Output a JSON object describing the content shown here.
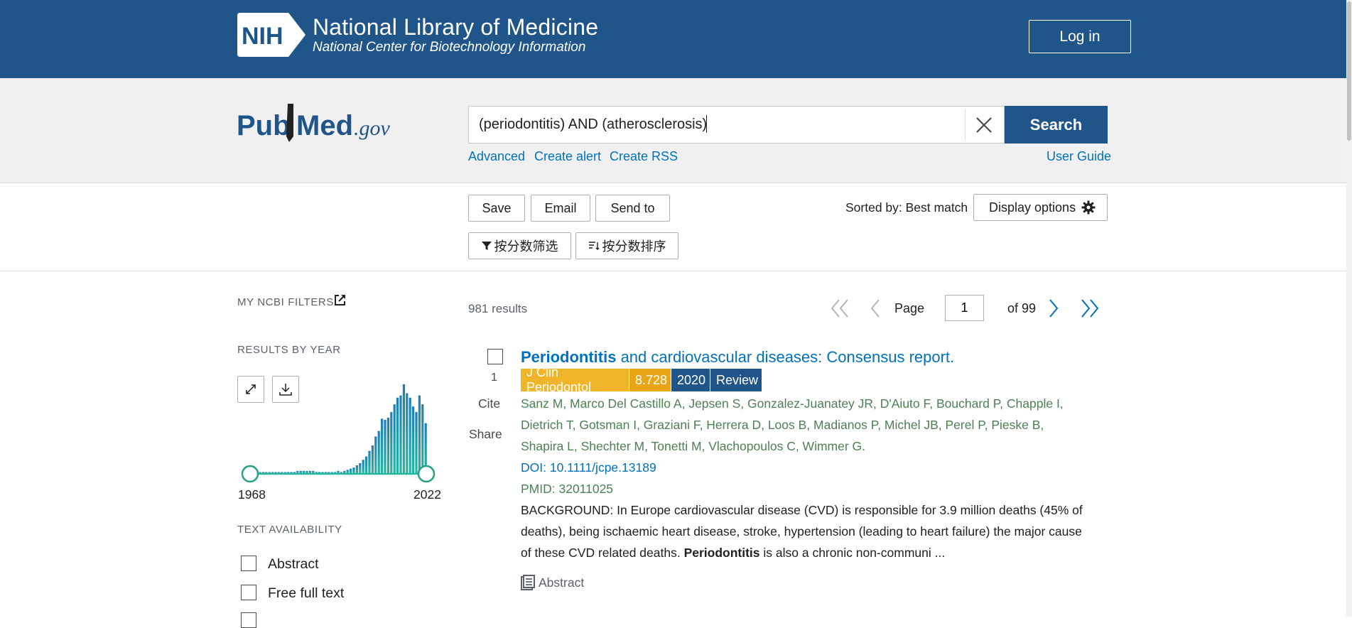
{
  "header": {
    "nih_logo_text": "NIH",
    "title": "National Library of Medicine",
    "subtitle": "National Center for Biotechnology Information",
    "login_label": "Log in"
  },
  "search": {
    "logo_text_pub": "Pub",
    "logo_text_med": "Med",
    "logo_text_gov": ".gov",
    "query": "(periodontitis) AND (atherosclerosis)",
    "button_label": "Search",
    "links": {
      "advanced": "Advanced",
      "create_alert": "Create alert",
      "create_rss": "Create RSS",
      "user_guide": "User Guide"
    }
  },
  "toolbar": {
    "save": "Save",
    "email": "Email",
    "send_to": "Send to",
    "sorted_by": "Sorted by: Best match",
    "display_options": "Display options",
    "filter_by_score": "按分数筛选",
    "sort_by_score": "按分数排序"
  },
  "sidebar": {
    "my_ncbi_filters": "MY NCBI FILTERS",
    "results_by_year": "RESULTS BY YEAR",
    "year_start": "1968",
    "year_end": "2022",
    "text_availability": "TEXT AVAILABILITY",
    "filters": [
      {
        "label": "Abstract",
        "checked": false
      },
      {
        "label": "Free full text",
        "checked": false
      }
    ],
    "histogram_counts": [
      1,
      1,
      1,
      1,
      1,
      1,
      1,
      1,
      1,
      1,
      1,
      1,
      1,
      2,
      2,
      2,
      2,
      2,
      2,
      1,
      1,
      1,
      1,
      1,
      1,
      1,
      2,
      1,
      2,
      3,
      4,
      5,
      7,
      9,
      12,
      15,
      20,
      25,
      33,
      38,
      49,
      48,
      50,
      55,
      62,
      68,
      70,
      80,
      72,
      68,
      60,
      55,
      70,
      62,
      45
    ]
  },
  "results": {
    "count": "981 results",
    "pagination": {
      "page_label": "Page",
      "current_page": "1",
      "of_label": "of 99"
    },
    "items": [
      {
        "number": "1",
        "cite": "Cite",
        "share": "Share",
        "title_highlight": "Periodontitis",
        "title_rest": " and cardiovascular diseases: Consensus report.",
        "journal": "J Clin Periodontol",
        "impact_factor": "8.728",
        "year": "2020",
        "type": "Review",
        "authors": "Sanz M, Marco Del Castillo A, Jepsen S, Gonzalez-Juanatey JR, D'Aiuto F, Bouchard P, Chapple I, Dietrich T, Gotsman I, Graziani F, Herrera D, Loos B, Madianos P, Michel JB, Perel P, Pieske B, Shapira L, Shechter M, Tonetti M, Vlachopoulos C, Wimmer G.",
        "doi": "DOI: 10.1111/jcpe.13189",
        "pmid": "PMID: 32011025",
        "abstract_before": "BACKGROUND: In Europe cardiovascular disease (CVD) is responsible for 3.9 million deaths (45% of deaths), being ischaemic heart disease, stroke, hypertension (leading to heart failure) the major cause of these CVD related deaths. ",
        "abstract_highlight": "Periodontitis",
        "abstract_after": " is also a chronic non-communi ...",
        "abstract_link": "Abstract"
      }
    ]
  },
  "colors": {
    "header_blue": "#20558a",
    "link_blue": "#0071bc",
    "author_green": "#4d8055",
    "journal_badge": "#f0b429",
    "if_badge": "#e8a617",
    "year_badge": "#20558a",
    "histogram_teal": "#26b6a0"
  }
}
